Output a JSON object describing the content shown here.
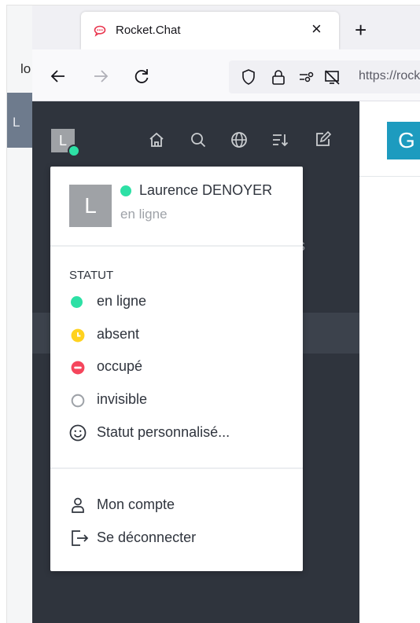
{
  "browser": {
    "tab_title": "Rocket.Chat",
    "tab_close": "×",
    "new_tab": "+",
    "url": "https://rocket.",
    "behind_window_text": "lo",
    "behind_window_letter": "L"
  },
  "sidebar": {
    "avatar_letter": "L",
    "partial_text": "s"
  },
  "main": {
    "button_letter": "G"
  },
  "user_menu": {
    "avatar_letter": "L",
    "user_name": "Laurence DENOYER",
    "user_status": "en ligne",
    "status_section_title": "STATUT",
    "status_options": [
      {
        "label": "en ligne",
        "color": "#2de0a5"
      },
      {
        "label": "absent",
        "color": "#ffd21f"
      },
      {
        "label": "occupé",
        "color": "#f5455c"
      },
      {
        "label": "invisible",
        "color": "#9ea2a8"
      }
    ],
    "custom_status": "Statut personnalisé...",
    "account_items": [
      {
        "label": "Mon compte",
        "icon": "user-icon"
      },
      {
        "label": "Se déconnecter",
        "icon": "logout-icon"
      }
    ]
  },
  "colors": {
    "sidebar_bg": "#2f343d",
    "online": "#2de0a5",
    "away": "#ffd21f",
    "busy": "#f5455c",
    "accent": "#1d9bbf"
  }
}
